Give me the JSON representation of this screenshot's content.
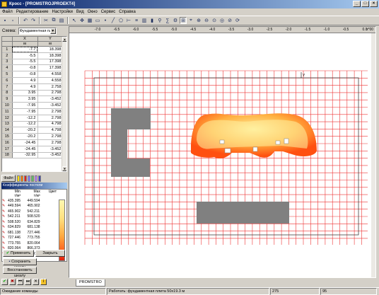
{
  "window": {
    "title": "Кросс - [PROMSTROJPROEKT4]"
  },
  "menu": [
    "Файл",
    "Редактирование",
    "Настройки",
    "Вид",
    "Окно",
    "Сервис",
    "Справка"
  ],
  "schema": {
    "label": "Схема:",
    "value": "Фундаментная плит"
  },
  "coord_table": {
    "headers": [
      "X",
      "Y"
    ],
    "units": [
      "м",
      "м"
    ],
    "rows": [
      [
        "1",
        "-7.7",
        "18.398"
      ],
      [
        "2",
        "-5.5",
        "18.398"
      ],
      [
        "3",
        "-5.5",
        "17.398"
      ],
      [
        "4",
        "-0.8",
        "17.398"
      ],
      [
        "5",
        "-0.8",
        "4.558"
      ],
      [
        "6",
        "4.9",
        "4.558"
      ],
      [
        "7",
        "4.9",
        "2.758"
      ],
      [
        "8",
        "3.95",
        "2.798"
      ],
      [
        "9",
        "3.95",
        "-3.452"
      ],
      [
        "10",
        "-7.95",
        "-3.452"
      ],
      [
        "11",
        "-7.95",
        "2.798"
      ],
      [
        "12",
        "-12.2",
        "2.798"
      ],
      [
        "13",
        "-12.2",
        "4.798"
      ],
      [
        "14",
        "-20.2",
        "4.798"
      ],
      [
        "15",
        "-20.2",
        "2.798"
      ],
      [
        "16",
        "-24.45",
        "2.798"
      ],
      [
        "17",
        "-24.45",
        "-3.452"
      ],
      [
        "18",
        "-32.95",
        "-3.452"
      ]
    ]
  },
  "palette": {
    "button_label": "Файл",
    "swatches": [
      "#ffe000",
      "#ff8000",
      "#e02020",
      "#8080ff",
      "#60c060",
      "#c080ff",
      "#4040c0"
    ]
  },
  "legend": {
    "title": "Коэффициенты постели",
    "headers": {
      "min": "Min",
      "max": "Max",
      "color": "Цвет"
    },
    "units": {
      "min": "т/м³",
      "max": "т/м³"
    },
    "rows": [
      [
        "435.395",
        "449.594"
      ],
      [
        "449.594",
        "465.902"
      ],
      [
        "465.902",
        "542.211"
      ],
      [
        "542.211",
        "508.520"
      ],
      [
        "508.520",
        "634.829"
      ],
      [
        "634.829",
        "681.138"
      ],
      [
        "681.138",
        "727.446"
      ],
      [
        "727.446",
        "773.755"
      ],
      [
        "773.755",
        "820.064"
      ],
      [
        "820.064",
        "866.373"
      ],
      [
        "866.373",
        "912.682"
      ]
    ]
  },
  "buttons": {
    "apply": "Применить",
    "close": "Закрыть",
    "save_scale": "Сохранить шкалу",
    "restore_scale": "Восстановить шкалу"
  },
  "ruler": {
    "units": "x*00",
    "x_ticks": [
      "-7.0",
      "-6.5",
      "-6.0",
      "-5.5",
      "-5.0",
      "-4.5",
      "-4.0",
      "-3.5",
      "-3.0",
      "-2.5",
      "-2.0",
      "-1.5",
      "-1.0",
      "-0.5",
      "0.0"
    ],
    "y_label": "Y"
  },
  "tab": {
    "label": "PROMSTRO"
  },
  "status": {
    "left": "Ожидание команды",
    "middle": "Работать: фундаментная плита 50х19.3 м",
    "cap": "275",
    "num": "95"
  },
  "colors": {
    "grid": "#ee3333",
    "block": "#808080",
    "heat_high": "#ff5010",
    "heat_mid": "#ffb040",
    "heat_low": "#fff0a0"
  }
}
